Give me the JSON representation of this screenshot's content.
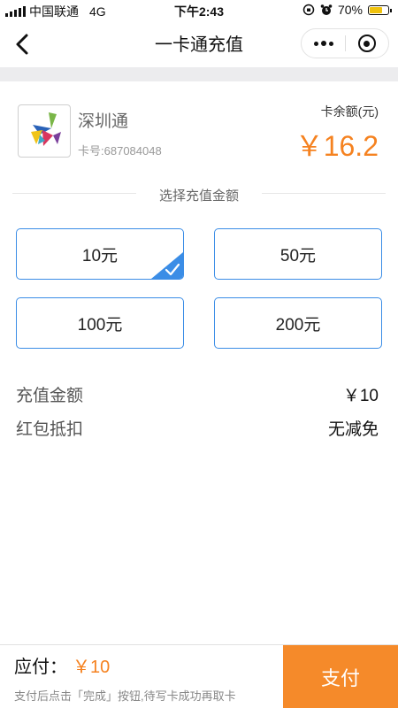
{
  "status_bar": {
    "carrier": "中国联通",
    "network": "4G",
    "time": "下午2:43",
    "battery_percent": "70%",
    "battery_level": 0.7
  },
  "nav": {
    "title": "一卡通充值",
    "icons": {
      "back": "back-chevron-icon",
      "more": "more-dots-icon",
      "close": "close-ring-icon"
    }
  },
  "card": {
    "name": "深圳通",
    "number_label": "卡号:",
    "number": "687084048",
    "balance_label": "卡余额(元)",
    "balance": "￥16.2",
    "logo_icon": "shenzhentong-logo"
  },
  "recharge": {
    "section_title": "选择充值金额",
    "options": [
      {
        "label": "10元",
        "selected": true
      },
      {
        "label": "50元",
        "selected": false
      },
      {
        "label": "100元",
        "selected": false
      },
      {
        "label": "200元",
        "selected": false
      }
    ]
  },
  "summary": {
    "amount_label": "充值金额",
    "amount_value": "￥10",
    "discount_label": "红包抵扣",
    "discount_value": "无减免"
  },
  "footer": {
    "pay_label": "应付：",
    "pay_amount": "￥10",
    "note": "支付后点击「完成」按钮,待写卡成功再取卡",
    "pay_button": "支付"
  },
  "colors": {
    "accent_orange": "#f58220",
    "pay_button": "#f58a2a",
    "selected_blue": "#3b8de6"
  }
}
